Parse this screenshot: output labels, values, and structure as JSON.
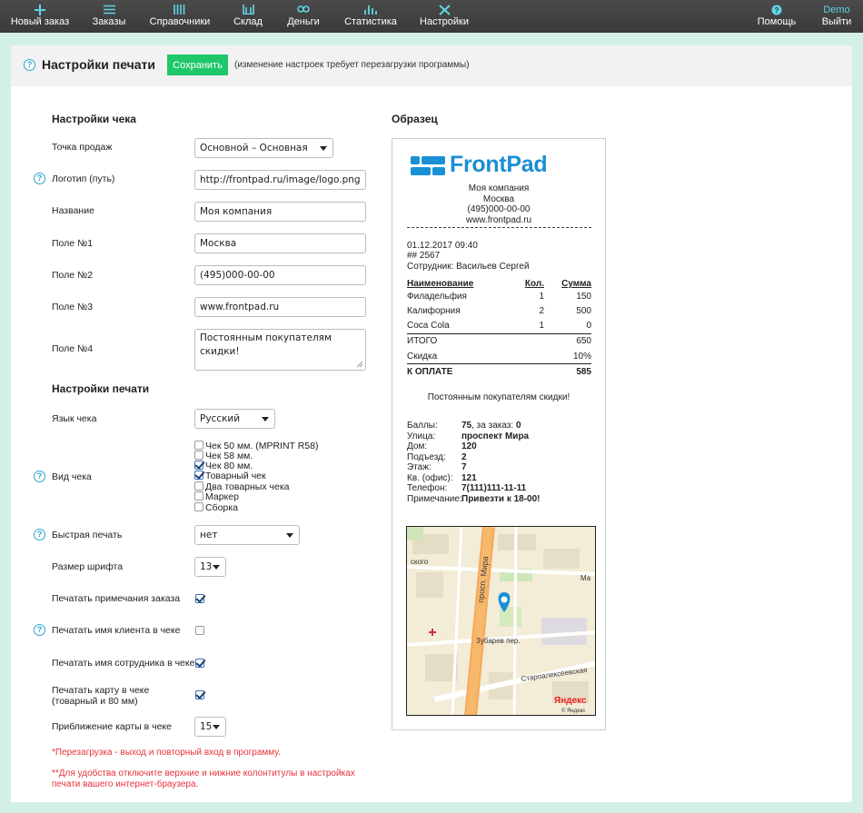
{
  "nav": {
    "items": [
      {
        "label": "Новый заказ",
        "icon": "plus-icon"
      },
      {
        "label": "Заказы",
        "icon": "list-icon"
      },
      {
        "label": "Справочники",
        "icon": "bars-icon"
      },
      {
        "label": "Склад",
        "icon": "warehouse-icon"
      },
      {
        "label": "Деньги",
        "icon": "money-icon"
      },
      {
        "label": "Статистика",
        "icon": "chart-icon"
      },
      {
        "label": "Настройки",
        "icon": "tools-icon"
      }
    ],
    "help": {
      "label": "Помощь",
      "icon": "help-icon"
    },
    "logout": {
      "user": "Demo",
      "label": "Выйти"
    }
  },
  "header": {
    "title": "Настройки печати",
    "save_label": "Сохранить",
    "note": "(изменение настроек требует перезагрузки программы)"
  },
  "receipt_settings": {
    "title": "Настройки чека",
    "point_of_sale": {
      "label": "Точка продаж",
      "value": "Основной – Основная"
    },
    "logo": {
      "label": "Логотип (путь)",
      "value": "http://frontpad.ru/image/logo.png"
    },
    "name": {
      "label": "Название",
      "value": "Моя компания"
    },
    "field1": {
      "label": "Поле №1",
      "value": "Москва"
    },
    "field2": {
      "label": "Поле №2",
      "value": "(495)000-00-00"
    },
    "field3": {
      "label": "Поле №3",
      "value": "www.frontpad.ru"
    },
    "field4": {
      "label": "Поле №4",
      "value": "Постоянным покупателям скидки!"
    }
  },
  "print_settings": {
    "title": "Настройки печати",
    "language": {
      "label": "Язык чека",
      "value": "Русский"
    },
    "receipt_type": {
      "label": "Вид чека",
      "options": [
        {
          "label": "Чек 50 мм. (MPRINT R58)",
          "checked": false
        },
        {
          "label": "Чек 58 мм.",
          "checked": false
        },
        {
          "label": "Чек 80 мм.",
          "checked": true
        },
        {
          "label": "Товарный чек",
          "checked": true
        },
        {
          "label": "Два товарных чека",
          "checked": false
        },
        {
          "label": "Маркер",
          "checked": false
        },
        {
          "label": "Сборка",
          "checked": false
        }
      ]
    },
    "quick_print": {
      "label": "Быстрая печать",
      "value": "нет"
    },
    "font_size": {
      "label": "Размер шрифта",
      "value": "13"
    },
    "print_notes": {
      "label": "Печатать примечания заказа",
      "checked": true
    },
    "print_client": {
      "label": "Печатать имя клиента в чеке",
      "checked": false
    },
    "print_employee": {
      "label": "Печатать имя сотрудника в чеке",
      "checked": true
    },
    "print_map": {
      "label_line1": "Печатать карту в чеке",
      "label_line2": "(товарный и 80 мм)",
      "checked": true
    },
    "map_zoom": {
      "label": "Приближение карты в чеке",
      "value": "15"
    }
  },
  "notes": {
    "reload": "*Перезагрузка - выход и повторный вход в программу.",
    "browser_line1": "**Для удобства отключите верхние и нижние колонтитулы в настройках",
    "browser_line2": "печати вашего интернет-браузера."
  },
  "sample": {
    "title": "Образец",
    "logo_text": "FrontPad",
    "company": "Моя компания",
    "city": "Москва",
    "phone": "(495)000-00-00",
    "site": "www.frontpad.ru",
    "datetime": "01.12.2017 09:40",
    "order_no": "## 2567",
    "employee": "Сотрудник: Васильев Сергей",
    "table_headers": {
      "name": "Наименование",
      "qty": "Кол.",
      "sum": "Сумма"
    },
    "items": [
      {
        "name": "Филадельфия",
        "qty": "1",
        "sum": "150"
      },
      {
        "name": "Калифорния",
        "qty": "2",
        "sum": "500"
      },
      {
        "name": "Coca Cola",
        "qty": "1",
        "sum": "0"
      }
    ],
    "total": {
      "label": "ИТОГО",
      "value": "650"
    },
    "discount": {
      "label": "Скидка",
      "value": "10%"
    },
    "to_pay": {
      "label": "К ОПЛАТЕ",
      "value": "585"
    },
    "footer": "Постоянным покупателям скидки!",
    "bonus": {
      "label": "Баллы:",
      "value": "75",
      "suffix_label": ", за заказ:",
      "suffix_value": "0"
    },
    "address": [
      {
        "label": "Улица:",
        "value": "проспект Мира"
      },
      {
        "label": "Дом:",
        "value": "120"
      },
      {
        "label": "Подъезд:",
        "value": "2"
      },
      {
        "label": "Этаж:",
        "value": "7"
      },
      {
        "label": "Кв. (офис):",
        "value": "121"
      },
      {
        "label": "Телефон:",
        "value": "7(111)111-11-11"
      },
      {
        "label": "Примечание:",
        "value": "Привезти к 18-00!"
      }
    ],
    "map": {
      "street_main": "просп. Мира",
      "street_left": "ского",
      "street_right": "Ма",
      "street_side": "Зубарев пер.",
      "street_bottom": "Староалексеевская",
      "brand": "Яндекс",
      "brand_sub": "© Яндекс"
    }
  }
}
